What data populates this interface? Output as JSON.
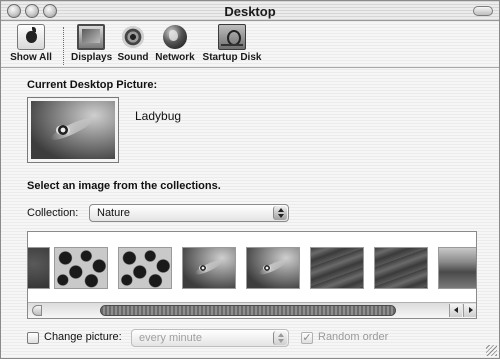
{
  "window": {
    "title": "Desktop"
  },
  "toolbar": {
    "items": [
      {
        "label": "Show All",
        "icon": "apple-icon"
      },
      {
        "label": "Displays",
        "icon": "display-icon"
      },
      {
        "label": "Sound",
        "icon": "speaker-icon"
      },
      {
        "label": "Network",
        "icon": "globe-icon"
      },
      {
        "label": "Startup Disk",
        "icon": "hard-disk-icon"
      }
    ]
  },
  "current": {
    "heading": "Current Desktop Picture:",
    "picture_name": "Ladybug"
  },
  "collections": {
    "instruction": "Select an image from the collections.",
    "label": "Collection:",
    "selected": "Nature"
  },
  "browser": {
    "thumbnails": [
      "edge",
      "leopard",
      "leopard",
      "ladybug",
      "ladybug",
      "sand",
      "sand",
      "dune"
    ]
  },
  "options": {
    "change_picture_label": "Change picture:",
    "change_picture_checked": false,
    "interval": "every minute",
    "random_order_label": "Random order",
    "random_order_checked": true,
    "checkmark": "✓"
  }
}
